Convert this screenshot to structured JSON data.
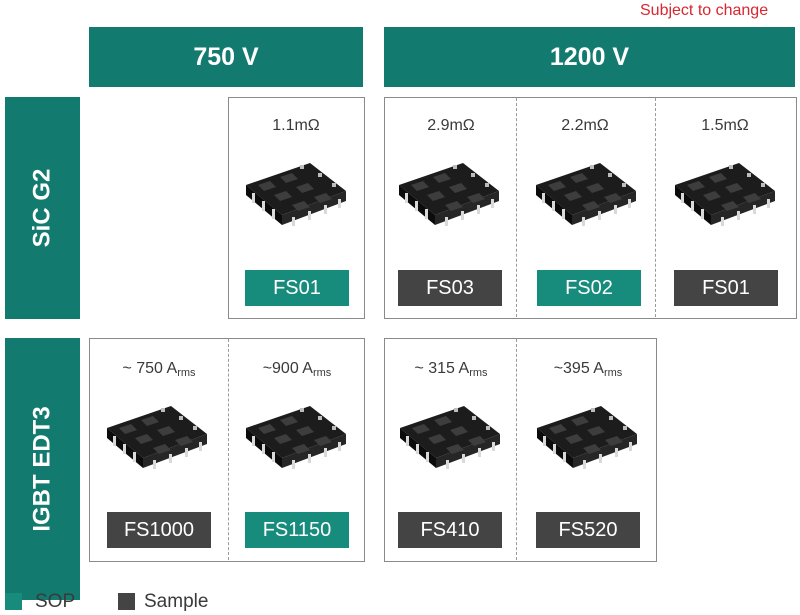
{
  "note": "Subject to change",
  "columns": {
    "v750": "750 V",
    "v1200": "1200 V"
  },
  "rows": {
    "sic": "SiC G2",
    "igbt": "IGBT EDT3"
  },
  "colors": {
    "sop": "#178b7c",
    "sample": "#444444",
    "header": "#127a6e",
    "note": "#d8262f"
  },
  "cells": {
    "sic_750_fs01": {
      "spec": "1.1mΩ",
      "label": "FS01",
      "status": "SOP"
    },
    "sic_1200_fs03": {
      "spec": "2.9mΩ",
      "label": "FS03",
      "status": "Sample"
    },
    "sic_1200_fs02": {
      "spec": "2.2mΩ",
      "label": "FS02",
      "status": "SOP"
    },
    "sic_1200_fs01": {
      "spec": "1.5mΩ",
      "label": "FS01",
      "status": "Sample"
    },
    "igbt_750_fs1000": {
      "spec_main": "~ 750 A",
      "spec_sub": "rms",
      "label": "FS1000",
      "status": "Sample"
    },
    "igbt_750_fs1150": {
      "spec_main": "~900 A",
      "spec_sub": "rms",
      "label": "FS1150",
      "status": "SOP"
    },
    "igbt_1200_fs410": {
      "spec_main": "~ 315 A",
      "spec_sub": "rms",
      "label": "FS410",
      "status": "Sample"
    },
    "igbt_1200_fs520": {
      "spec_main": "~395 A",
      "spec_sub": "rms",
      "label": "FS520",
      "status": "Sample"
    }
  },
  "legend": {
    "sop": "SOP",
    "sample": "Sample"
  },
  "icons": {
    "module": "power-module-icon"
  }
}
